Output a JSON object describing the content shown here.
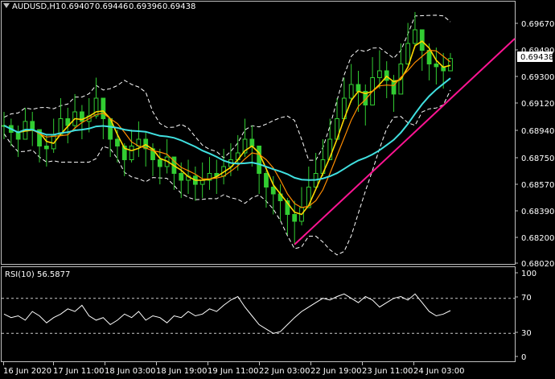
{
  "header": {
    "symbol": "AUDUSD,H1",
    "open": "0.69407",
    "high": "0.69446",
    "low": "0.69396",
    "close": "0.69438"
  },
  "rsi_panel": {
    "label": "RSI(10) 56.5877"
  },
  "current_price_label": "0.69438",
  "colors": {
    "background": "#000000",
    "frame": "#c0c0c0",
    "candles": "#32cd32",
    "ma_fast": "#ffd700",
    "ma_mid": "#ff8c00",
    "ma_slow": "#40e0e0",
    "bands": "#ffffff",
    "trendline": "#ff1493",
    "rsi_line": "#ffffff",
    "rsi_levels": "#ffffff"
  },
  "chart_data": [
    {
      "type": "candlestick",
      "title": "AUDUSD,H1",
      "y_ticks": [
        "0.69670",
        "0.69490",
        "0.69300",
        "0.69120",
        "0.68940",
        "0.68750",
        "0.68570",
        "0.68390",
        "0.68200",
        "0.68020"
      ],
      "ylim": [
        0.6795,
        0.6975
      ],
      "x_ticks": [
        "16 Jun 2020",
        "17 Jun 11:00",
        "18 Jun 03:00",
        "18 Jun 19:00",
        "19 Jun 11:00",
        "22 Jun 03:00",
        "22 Jun 19:00",
        "23 Jun 11:00",
        "24 Jun 03:00"
      ],
      "close_series": [
        0.6895,
        0.689,
        0.6885,
        0.6898,
        0.6892,
        0.688,
        0.6878,
        0.6888,
        0.69,
        0.6895,
        0.6905,
        0.6898,
        0.6902,
        0.6915,
        0.69,
        0.6885,
        0.688,
        0.687,
        0.688,
        0.6885,
        0.6878,
        0.687,
        0.6865,
        0.6872,
        0.686,
        0.6855,
        0.6858,
        0.6852,
        0.6855,
        0.686,
        0.6858,
        0.6865,
        0.687,
        0.6875,
        0.6885,
        0.688,
        0.686,
        0.685,
        0.6845,
        0.684,
        0.683,
        0.6825,
        0.6835,
        0.685,
        0.686,
        0.687,
        0.6885,
        0.69,
        0.6915,
        0.6925,
        0.692,
        0.691,
        0.693,
        0.6935,
        0.6928,
        0.6918,
        0.694,
        0.6955,
        0.6965,
        0.695,
        0.694,
        0.6938,
        0.6935,
        0.6944
      ],
      "high_series": [
        0.6905,
        0.69,
        0.6895,
        0.6908,
        0.6905,
        0.689,
        0.6888,
        0.69,
        0.6915,
        0.6908,
        0.6918,
        0.691,
        0.6915,
        0.693,
        0.6915,
        0.6898,
        0.6892,
        0.6882,
        0.6892,
        0.6898,
        0.689,
        0.6882,
        0.6878,
        0.6885,
        0.6872,
        0.6868,
        0.687,
        0.6865,
        0.6868,
        0.6872,
        0.687,
        0.6878,
        0.6882,
        0.6888,
        0.69,
        0.6895,
        0.6875,
        0.6862,
        0.6858,
        0.6852,
        0.6842,
        0.684,
        0.685,
        0.6865,
        0.6875,
        0.6885,
        0.69,
        0.6915,
        0.693,
        0.694,
        0.6935,
        0.6925,
        0.6945,
        0.695,
        0.6942,
        0.6932,
        0.6955,
        0.697,
        0.6978,
        0.6965,
        0.6955,
        0.6952,
        0.6948,
        0.6948
      ],
      "low_series": [
        0.6885,
        0.688,
        0.6872,
        0.6885,
        0.688,
        0.6868,
        0.6865,
        0.6875,
        0.6888,
        0.6882,
        0.6892,
        0.6885,
        0.689,
        0.69,
        0.6885,
        0.6872,
        0.6868,
        0.6858,
        0.6868,
        0.6872,
        0.6865,
        0.6858,
        0.6852,
        0.686,
        0.6848,
        0.6842,
        0.6845,
        0.684,
        0.6842,
        0.6848,
        0.6845,
        0.6852,
        0.6858,
        0.6862,
        0.6872,
        0.6865,
        0.6845,
        0.6835,
        0.683,
        0.6825,
        0.6815,
        0.6808,
        0.6822,
        0.6838,
        0.6848,
        0.6858,
        0.6872,
        0.6888,
        0.6902,
        0.6912,
        0.6905,
        0.6895,
        0.6918,
        0.6922,
        0.6915,
        0.6905,
        0.6928,
        0.6942,
        0.6952,
        0.6935,
        0.6928,
        0.6925,
        0.6922,
        0.6938
      ],
      "indicators": [
        "moving averages",
        "envelope bands",
        "trendline"
      ]
    },
    {
      "type": "line",
      "title": "RSI(10) 56.5877",
      "y_ticks": [
        "100",
        "70",
        "30",
        "0"
      ],
      "ylim": [
        0,
        100
      ],
      "levels": [
        70,
        30
      ],
      "values": [
        52,
        48,
        50,
        45,
        55,
        50,
        42,
        48,
        52,
        58,
        55,
        62,
        50,
        45,
        48,
        40,
        45,
        52,
        48,
        55,
        45,
        50,
        48,
        42,
        50,
        48,
        55,
        50,
        52,
        58,
        55,
        62,
        68,
        72,
        60,
        50,
        40,
        35,
        30,
        32,
        40,
        48,
        55,
        60,
        65,
        70,
        68,
        72,
        75,
        70,
        65,
        72,
        68,
        60,
        65,
        70,
        72,
        68,
        75,
        65,
        55,
        50,
        52,
        56
      ]
    }
  ]
}
